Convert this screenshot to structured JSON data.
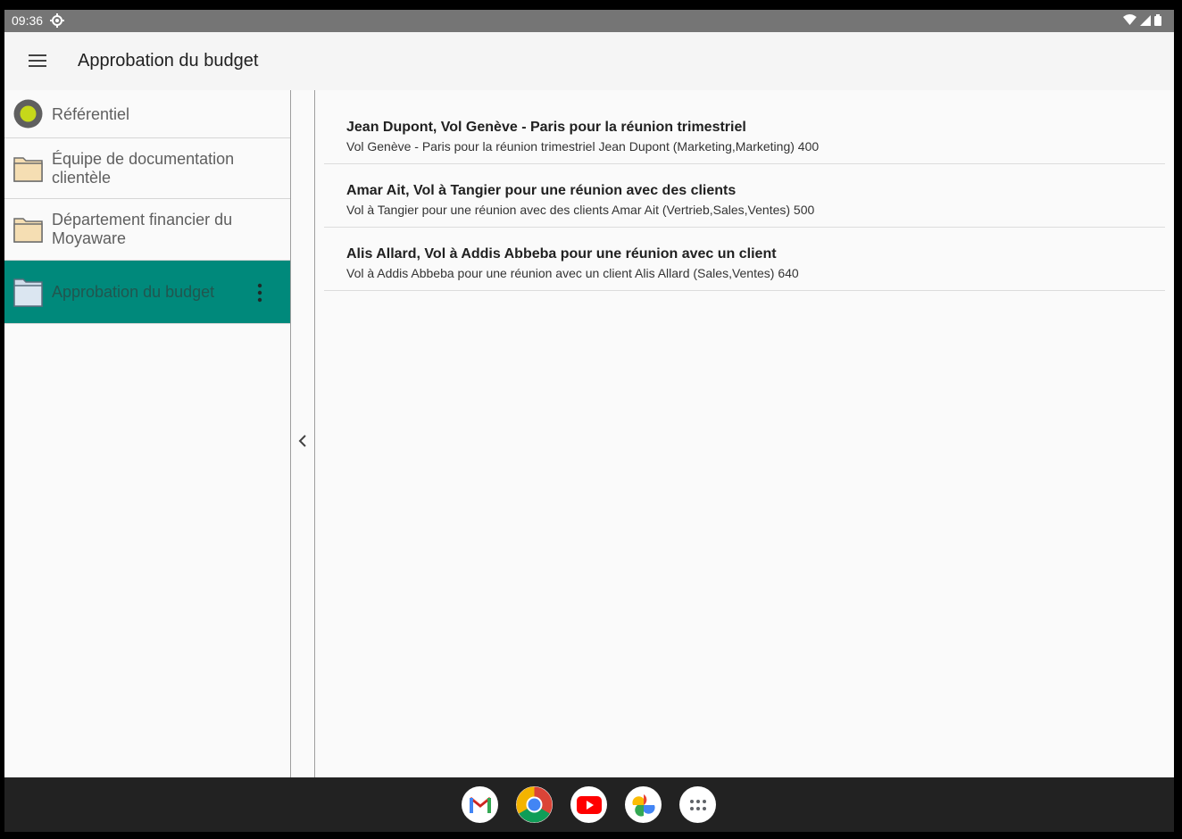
{
  "status_bar": {
    "time": "09:36"
  },
  "app_bar": {
    "title": "Approbation du budget"
  },
  "colors": {
    "accent": "#00897b",
    "folder": "#f5deb3",
    "status_bar": "#757575",
    "taskbar": "#222222"
  },
  "sidebar": {
    "items": [
      {
        "label": "Référentiel",
        "icon": "repository-icon"
      },
      {
        "label": "Équipe de documentation clientèle",
        "icon": "folder-icon"
      },
      {
        "label": "Département financier du Moyaware",
        "icon": "folder-icon"
      },
      {
        "label": "Approbation du budget",
        "icon": "folder-icon",
        "selected": true
      }
    ]
  },
  "list": {
    "items": [
      {
        "title": "Jean Dupont, Vol Genève - Paris pour la réunion trimestriel",
        "subtitle": "Vol Genève - Paris pour la réunion trimestriel Jean Dupont (Marketing,Marketing) 400"
      },
      {
        "title": "Amar Ait, Vol à Tangier pour une réunion avec des clients",
        "subtitle": "Vol à Tangier pour une réunion avec des clients Amar Ait (Vertrieb,Sales,Ventes) 500"
      },
      {
        "title": "Alis Allard, Vol à Addis Abbeba pour une réunion avec un client",
        "subtitle": "Vol à Addis Abbeba pour une réunion avec un client Alis Allard (Sales,Ventes) 640"
      }
    ]
  },
  "dock": {
    "apps": [
      "gmail-icon",
      "chrome-icon",
      "youtube-icon",
      "photos-icon",
      "app-drawer-icon"
    ]
  }
}
